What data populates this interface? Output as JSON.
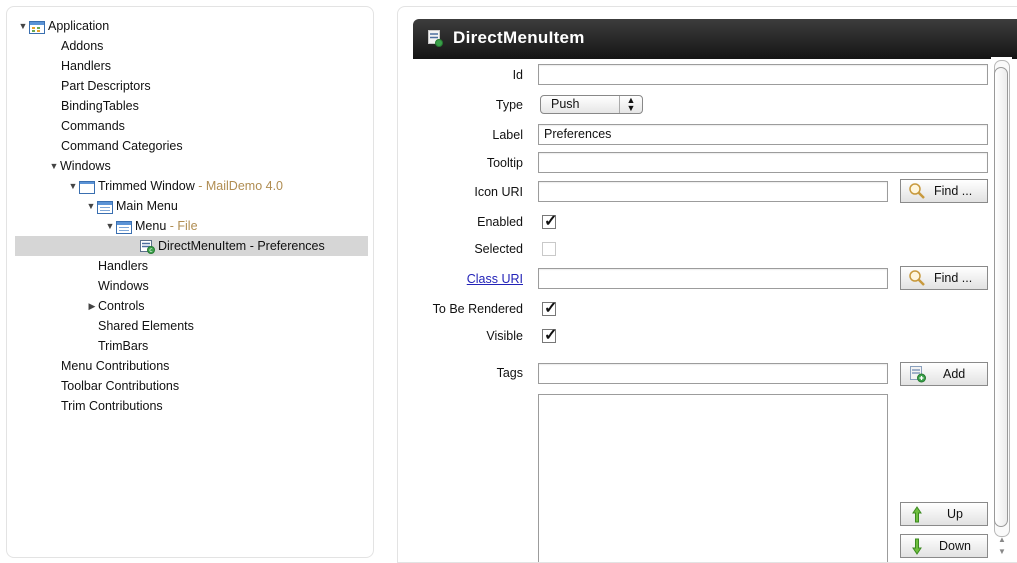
{
  "tree": {
    "items": [
      {
        "label": "Application",
        "suffix": ""
      },
      {
        "label": "Addons",
        "suffix": ""
      },
      {
        "label": "Handlers",
        "suffix": ""
      },
      {
        "label": "Part Descriptors",
        "suffix": ""
      },
      {
        "label": "BindingTables",
        "suffix": ""
      },
      {
        "label": "Commands",
        "suffix": ""
      },
      {
        "label": "Command Categories",
        "suffix": ""
      },
      {
        "label": "Windows",
        "suffix": ""
      },
      {
        "label": "Trimmed Window",
        "suffix": " - MailDemo 4.0"
      },
      {
        "label": "Main Menu",
        "suffix": ""
      },
      {
        "label": "Menu",
        "suffix": " - File"
      },
      {
        "label": "DirectMenuItem - Preferences",
        "suffix": ""
      },
      {
        "label": "Handlers",
        "suffix": ""
      },
      {
        "label": "Windows",
        "suffix": ""
      },
      {
        "label": "Controls",
        "suffix": ""
      },
      {
        "label": "Shared Elements",
        "suffix": ""
      },
      {
        "label": "TrimBars",
        "suffix": ""
      },
      {
        "label": "Menu Contributions",
        "suffix": ""
      },
      {
        "label": "Toolbar Contributions",
        "suffix": ""
      },
      {
        "label": "Trim Contributions",
        "suffix": ""
      }
    ]
  },
  "editor": {
    "title": "DirectMenuItem",
    "labels": {
      "id": "Id",
      "type": "Type",
      "label": "Label",
      "tooltip": "Tooltip",
      "icon_uri": "Icon URI",
      "enabled": "Enabled",
      "selected": "Selected",
      "class_uri": "Class URI",
      "to_be_rendered": "To Be Rendered",
      "visible": "Visible",
      "tags": "Tags"
    },
    "values": {
      "id": "",
      "type": "Push",
      "label": "Preferences",
      "tooltip": "",
      "icon_uri": "",
      "class_uri": "",
      "tags": "",
      "enabled": true,
      "selected": false,
      "to_be_rendered": true,
      "visible": true
    },
    "buttons": {
      "find": "Find ...",
      "add": "Add",
      "up": "Up",
      "down": "Down"
    }
  },
  "colors": {
    "title_bar": "#1e1e1e",
    "suffix_text": "#b08d52",
    "selection": "#d6d6d6",
    "link": "#2323b8"
  }
}
